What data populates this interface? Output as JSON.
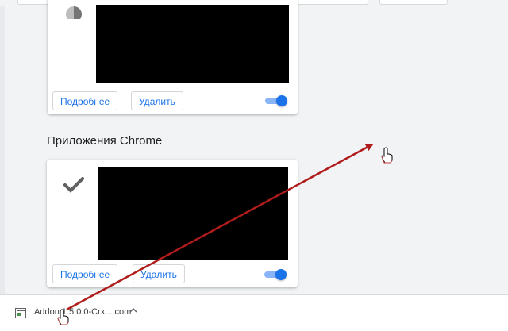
{
  "window": {
    "left_strip_color": "#e8eaed"
  },
  "cards": [
    {
      "more_label": "Подробнее",
      "remove_label": "Удалить",
      "enabled": true,
      "icon": "pie-chart-icon"
    },
    {
      "more_label": "Подробнее",
      "remove_label": "Удалить",
      "enabled": true,
      "icon": "checkmark-icon"
    }
  ],
  "section": {
    "title": "Приложения Chrome"
  },
  "download_bar": {
    "file_name": "Addon 1.5.0.0-Crx....com",
    "file_icon": "file-icon",
    "menu_icon": "chevron-up-icon"
  },
  "annotation": {
    "arrow_color": "#b01c1c",
    "cursor_icon": "hand-pointer-icon"
  },
  "colors": {
    "accent": "#1a73e8",
    "toggle_track": "#8ab4f8",
    "background": "#f1f3f4"
  }
}
